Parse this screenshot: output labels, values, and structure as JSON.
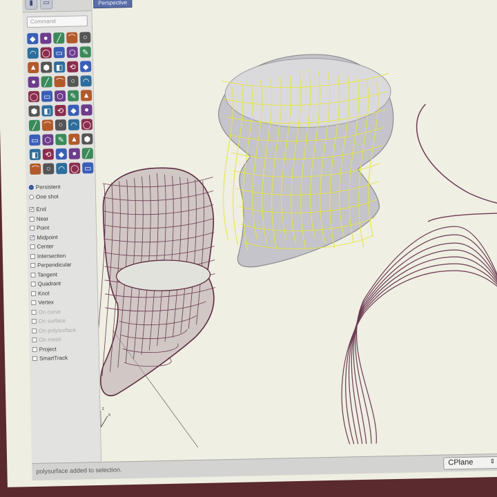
{
  "sidebar": {
    "command_placeholder": "Command",
    "osnap_mode": [
      "Persistent",
      "One shot"
    ],
    "osnaps": [
      {
        "label": "End",
        "checked": true,
        "dim": false
      },
      {
        "label": "Near",
        "checked": false,
        "dim": false
      },
      {
        "label": "Point",
        "checked": false,
        "dim": false
      },
      {
        "label": "Midpoint",
        "checked": true,
        "dim": false
      },
      {
        "label": "Center",
        "checked": false,
        "dim": false
      },
      {
        "label": "Intersection",
        "checked": false,
        "dim": false
      },
      {
        "label": "Perpendicular",
        "checked": false,
        "dim": false
      },
      {
        "label": "Tangent",
        "checked": false,
        "dim": false
      },
      {
        "label": "Quadrant",
        "checked": false,
        "dim": false
      },
      {
        "label": "Knot",
        "checked": false,
        "dim": false
      },
      {
        "label": "Vertex",
        "checked": false,
        "dim": false
      },
      {
        "label": "On curve",
        "checked": false,
        "dim": true
      },
      {
        "label": "On surface",
        "checked": false,
        "dim": true
      },
      {
        "label": "On polysurface",
        "checked": false,
        "dim": true
      },
      {
        "label": "On mesh",
        "checked": false,
        "dim": true
      },
      {
        "label": "Project",
        "checked": false,
        "dim": false
      },
      {
        "label": "SmartTrack",
        "checked": false,
        "dim": false
      }
    ]
  },
  "viewport": {
    "name": "Perspective",
    "axis_x": "x",
    "axis_y": "y",
    "axis_z": "z"
  },
  "statusbar": {
    "message": "polysurface added to selection.",
    "cplane": "CPlane"
  },
  "colors": {
    "wire": "#6b3a52",
    "selection": "#e6e63c",
    "surface": "#c4c4ca",
    "accent": "#3a5fb8"
  }
}
